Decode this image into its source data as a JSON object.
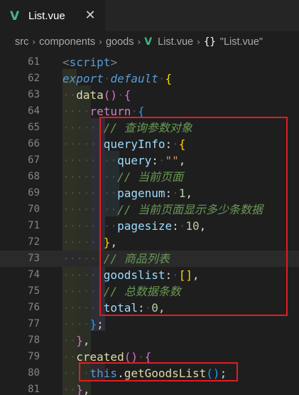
{
  "tab": {
    "title": "List.vue",
    "icon": "vue-icon",
    "close": "✕"
  },
  "breadcrumb": {
    "segments": [
      "src",
      "components",
      "goods",
      "List.vue",
      "\"List.vue\""
    ],
    "braces": "{}",
    "separator": "›"
  },
  "editor": {
    "lines": [
      {
        "n": "61",
        "indent": 2,
        "parts": [
          [
            "t-br",
            "<"
          ],
          [
            "t-tag",
            "script"
          ],
          [
            "t-br",
            ">"
          ]
        ]
      },
      {
        "n": "62",
        "indent": 2,
        "parts": [
          [
            "t-kw",
            "export"
          ],
          [
            "",
            "·"
          ],
          [
            "t-kw",
            "default"
          ],
          [
            "",
            "·"
          ],
          [
            "t-p1",
            "{"
          ]
        ]
      },
      {
        "n": "63",
        "indent": 3,
        "parts": [
          [
            "t-fn",
            "data"
          ],
          [
            "t-p2",
            "()"
          ],
          [
            "",
            "·"
          ],
          [
            "t-p2",
            "{"
          ]
        ]
      },
      {
        "n": "64",
        "indent": 4,
        "parts": [
          [
            "t-ctrl",
            "return"
          ],
          [
            "",
            "·"
          ],
          [
            "t-p3",
            "{"
          ]
        ]
      },
      {
        "n": "65",
        "indent": 5,
        "parts": [
          [
            "t-com",
            "// 查询参数对象"
          ]
        ]
      },
      {
        "n": "66",
        "indent": 5,
        "parts": [
          [
            "t-prop",
            "queryInfo"
          ],
          [
            "",
            ":"
          ],
          [
            "",
            "·"
          ],
          [
            "t-p1",
            "{"
          ]
        ]
      },
      {
        "n": "67",
        "indent": 6,
        "parts": [
          [
            "t-prop",
            "query"
          ],
          [
            "",
            ":"
          ],
          [
            "",
            "·"
          ],
          [
            "t-str",
            "\"\""
          ],
          [
            "",
            ","
          ]
        ]
      },
      {
        "n": "68",
        "indent": 6,
        "parts": [
          [
            "t-com",
            "// 当前页面"
          ]
        ]
      },
      {
        "n": "69",
        "indent": 6,
        "parts": [
          [
            "t-prop",
            "pagenum"
          ],
          [
            "",
            ":"
          ],
          [
            "",
            "·"
          ],
          [
            "t-num",
            "1"
          ],
          [
            "",
            ","
          ]
        ]
      },
      {
        "n": "70",
        "indent": 6,
        "parts": [
          [
            "t-com",
            "// 当前页面显示多少条数据"
          ]
        ]
      },
      {
        "n": "71",
        "indent": 6,
        "parts": [
          [
            "t-prop",
            "pagesize"
          ],
          [
            "",
            ":"
          ],
          [
            "",
            "·"
          ],
          [
            "t-num",
            "10"
          ],
          [
            "",
            ","
          ]
        ]
      },
      {
        "n": "72",
        "indent": 5,
        "parts": [
          [
            "t-p1",
            "}"
          ],
          [
            "",
            ","
          ]
        ]
      },
      {
        "n": "73",
        "indent": 5,
        "parts": [
          [
            "t-com",
            "// 商品列表"
          ]
        ],
        "current": true
      },
      {
        "n": "74",
        "indent": 5,
        "parts": [
          [
            "t-prop",
            "goodslist"
          ],
          [
            "",
            ":"
          ],
          [
            "",
            "·"
          ],
          [
            "t-p1",
            "[]"
          ],
          [
            "",
            ","
          ]
        ]
      },
      {
        "n": "75",
        "indent": 5,
        "parts": [
          [
            "t-com",
            "// 总数据条数"
          ]
        ]
      },
      {
        "n": "76",
        "indent": 5,
        "parts": [
          [
            "t-prop",
            "total"
          ],
          [
            "",
            ":"
          ],
          [
            "",
            "·"
          ],
          [
            "t-num",
            "0"
          ],
          [
            "",
            ","
          ]
        ]
      },
      {
        "n": "77",
        "indent": 4,
        "parts": [
          [
            "t-p3",
            "}"
          ],
          [
            "",
            ";"
          ]
        ]
      },
      {
        "n": "78",
        "indent": 3,
        "parts": [
          [
            "t-p2",
            "}"
          ],
          [
            "",
            ","
          ]
        ]
      },
      {
        "n": "79",
        "indent": 3,
        "parts": [
          [
            "t-fn",
            "created"
          ],
          [
            "t-p2",
            "()"
          ],
          [
            "",
            "·"
          ],
          [
            "t-p2",
            "{"
          ]
        ]
      },
      {
        "n": "80",
        "indent": 4,
        "parts": [
          [
            "t-tag",
            "this"
          ],
          [
            "",
            "."
          ],
          [
            "t-fn",
            "getGoodsList"
          ],
          [
            "t-p3",
            "()"
          ],
          [
            "",
            ";"
          ]
        ]
      },
      {
        "n": "81",
        "indent": 3,
        "parts": [
          [
            "t-p2",
            "}"
          ],
          [
            "",
            ","
          ]
        ]
      }
    ]
  },
  "colors": {
    "accent_vue": "#41b883",
    "highlight_box": "#e51b23",
    "background": "#1e1e1e"
  }
}
